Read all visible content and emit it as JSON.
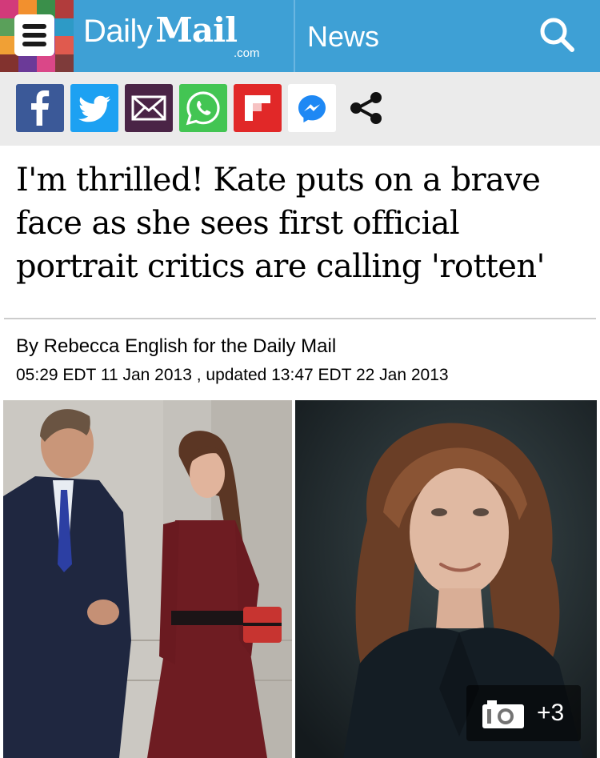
{
  "header": {
    "logo_daily": "Daily",
    "logo_mail": "Mail",
    "logo_dotcom": ".com",
    "section": "News",
    "menu_icon": "hamburger-menu-icon",
    "search_icon": "search-icon",
    "bar_color": "#3ea0d5",
    "mosaic_colors": [
      "#d23a7a",
      "#f2902e",
      "#3a8f4a",
      "#b13c3c",
      "#5aa05a",
      "#c0458c",
      "#3a76c8",
      "#2d9ac6",
      "#f0a035",
      "#37a0c9",
      "#9a3c8a",
      "#e05a4e",
      "#82322e",
      "#6b3a98",
      "#da4788",
      "#7e3b3a"
    ]
  },
  "share": [
    {
      "name": "facebook",
      "icon": "facebook-icon",
      "color": "#3b5998"
    },
    {
      "name": "twitter",
      "icon": "twitter-icon",
      "color": "#1da1f2"
    },
    {
      "name": "email",
      "icon": "email-icon",
      "color": "#4a2446"
    },
    {
      "name": "whatsapp",
      "icon": "whatsapp-icon",
      "color": "#43c553"
    },
    {
      "name": "flipboard",
      "icon": "flipboard-icon",
      "color": "#e12828"
    },
    {
      "name": "messenger",
      "icon": "messenger-icon",
      "color": "#ffffff"
    },
    {
      "name": "share",
      "icon": "share-icon",
      "color": "#111111"
    }
  ],
  "article": {
    "headline": "I'm thrilled! Kate puts on a brave face as she sees first official portrait critics are calling 'rotten'",
    "byline": "By Rebecca English for the Daily Mail",
    "dateline": "05:29 EDT 11 Jan 2013 , updated 13:47 EDT 22 Jan 2013"
  },
  "gallery": {
    "icon": "camera-icon",
    "count": "+3"
  }
}
